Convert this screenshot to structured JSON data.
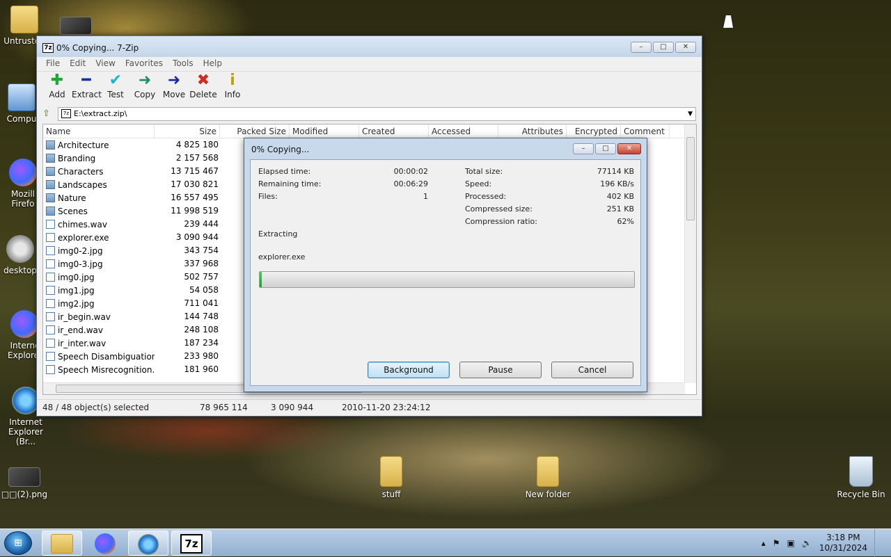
{
  "desktop": {
    "icons": [
      {
        "label": "Untrusted"
      },
      {
        "label": "Compu"
      },
      {
        "label": "Mozill Firefo"
      },
      {
        "label": "desktop"
      },
      {
        "label": "Interne Explorer"
      },
      {
        "label": "Internet Explorer (Br..."
      },
      {
        "label": "□□(2).png"
      },
      {
        "label": "stuff"
      },
      {
        "label": "New folder"
      },
      {
        "label": "Recycle Bin"
      }
    ]
  },
  "window": {
    "title": "0% Copying... 7-Zip",
    "app_icon": "7z",
    "caption": {
      "minimize": "–",
      "maximize": "□",
      "close": "✕"
    },
    "menu": [
      "File",
      "Edit",
      "View",
      "Favorites",
      "Tools",
      "Help"
    ],
    "toolbar": [
      {
        "label": "Add",
        "glyph": "✚",
        "color": "#22a63a",
        "icon": "add-icon"
      },
      {
        "label": "Extract",
        "glyph": "━",
        "color": "#1a2ea8",
        "icon": "extract-icon"
      },
      {
        "label": "Test",
        "glyph": "✔",
        "color": "#18b7c9",
        "icon": "test-icon"
      },
      {
        "label": "Copy",
        "glyph": "➜",
        "color": "#1e8c6a",
        "icon": "copy-icon"
      },
      {
        "label": "Move",
        "glyph": "➜",
        "color": "#1a2aa0",
        "icon": "move-icon"
      },
      {
        "label": "Delete",
        "glyph": "✖",
        "color": "#d42a1c",
        "icon": "delete-icon"
      },
      {
        "label": "Info",
        "glyph": "i",
        "color": "#b8a400",
        "icon": "info-icon"
      }
    ],
    "address": "E:\\extract.zip\\",
    "columns": [
      "Name",
      "Size",
      "Packed Size",
      "Modified",
      "Created",
      "Accessed",
      "Attributes",
      "Encrypted",
      "Comment"
    ],
    "files": [
      {
        "name": "Architecture",
        "size": "4 825 180",
        "type": "folder"
      },
      {
        "name": "Branding",
        "size": "2 157 568",
        "type": "folder"
      },
      {
        "name": "Characters",
        "size": "13 715 467",
        "type": "folder"
      },
      {
        "name": "Landscapes",
        "size": "17 030 821",
        "type": "folder"
      },
      {
        "name": "Nature",
        "size": "16 557 495",
        "type": "folder"
      },
      {
        "name": "Scenes",
        "size": "11 998 519",
        "type": "folder"
      },
      {
        "name": "chimes.wav",
        "size": "239 444",
        "type": "file"
      },
      {
        "name": "explorer.exe",
        "size": "3 090 944",
        "type": "file"
      },
      {
        "name": "img0-2.jpg",
        "size": "343 754",
        "type": "file"
      },
      {
        "name": "img0-3.jpg",
        "size": "337 968",
        "type": "file"
      },
      {
        "name": "img0.jpg",
        "size": "502 757",
        "type": "file"
      },
      {
        "name": "img1.jpg",
        "size": "54 058",
        "type": "file"
      },
      {
        "name": "img2.jpg",
        "size": "711 041",
        "type": "file"
      },
      {
        "name": "ir_begin.wav",
        "size": "144 748",
        "type": "file"
      },
      {
        "name": "ir_end.wav",
        "size": "248 108",
        "type": "file"
      },
      {
        "name": "ir_inter.wav",
        "size": "187 234",
        "type": "file"
      },
      {
        "name": "Speech Disambiguation....",
        "size": "233 980",
        "type": "file"
      },
      {
        "name": "Speech Misrecognition....",
        "size": "181 960",
        "type": "file"
      }
    ],
    "status": {
      "selected": "48 / 48 object(s) selected",
      "total": "78 965 114",
      "item_size": "3 090 944",
      "modified": "2010-11-20 23:24:12"
    }
  },
  "dialog": {
    "title": "0% Copying...",
    "left": [
      {
        "label": "Elapsed time:",
        "value": "00:00:02"
      },
      {
        "label": "Remaining time:",
        "value": "00:06:29"
      },
      {
        "label": "Files:",
        "value": "1"
      }
    ],
    "right": [
      {
        "label": "Total size:",
        "value": "77114 KB"
      },
      {
        "label": "Speed:",
        "value": "196 KB/s"
      },
      {
        "label": "Processed:",
        "value": "402 KB"
      },
      {
        "label": "Compressed size:",
        "value": "251 KB"
      },
      {
        "label": "Compression ratio:",
        "value": "62%"
      }
    ],
    "operation": "Extracting",
    "current_file": "explorer.exe",
    "progress": 0.005,
    "buttons": {
      "background": "Background",
      "pause": "Pause",
      "cancel": "Cancel"
    }
  },
  "taskbar": {
    "clock_time": "3:18 PM",
    "clock_date": "10/31/2024",
    "tray_arrow": "▴"
  }
}
